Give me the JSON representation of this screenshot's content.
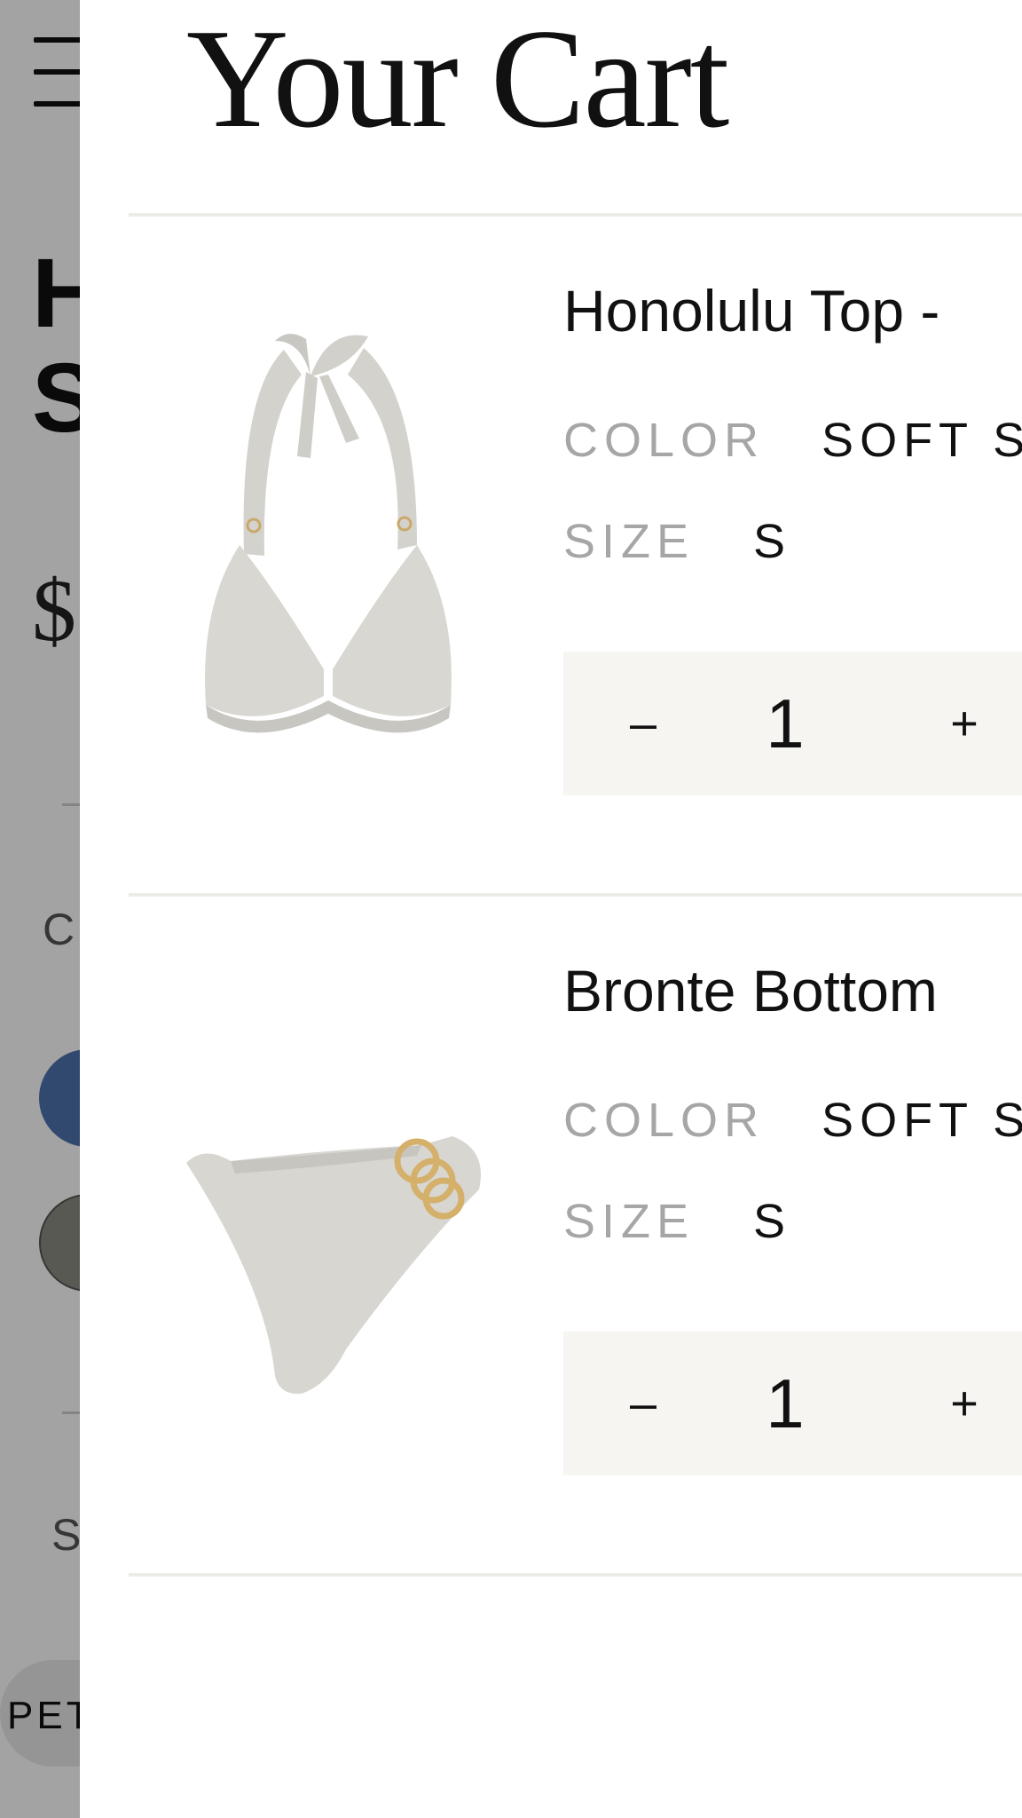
{
  "background_page": {
    "title_partial": "H\nS",
    "price_partial": "$",
    "color_label_partial": "C",
    "size_label_partial": "S",
    "size_option_partial": "PET",
    "swatches": [
      "#4d72ad",
      "#8b8b83"
    ]
  },
  "cart": {
    "title": "Your Cart",
    "items": [
      {
        "name": "Honolulu Top - ",
        "color_label": "COLOR",
        "color_value": "SOFT S",
        "size_label": "SIZE",
        "size_value": "S",
        "quantity": "1",
        "minus_label": "–",
        "plus_label": "+"
      },
      {
        "name": "Bronte Bottom",
        "color_label": "COLOR",
        "color_value": "SOFT S",
        "size_label": "SIZE",
        "size_value": "S",
        "quantity": "1",
        "minus_label": "–",
        "plus_label": "+"
      }
    ]
  }
}
